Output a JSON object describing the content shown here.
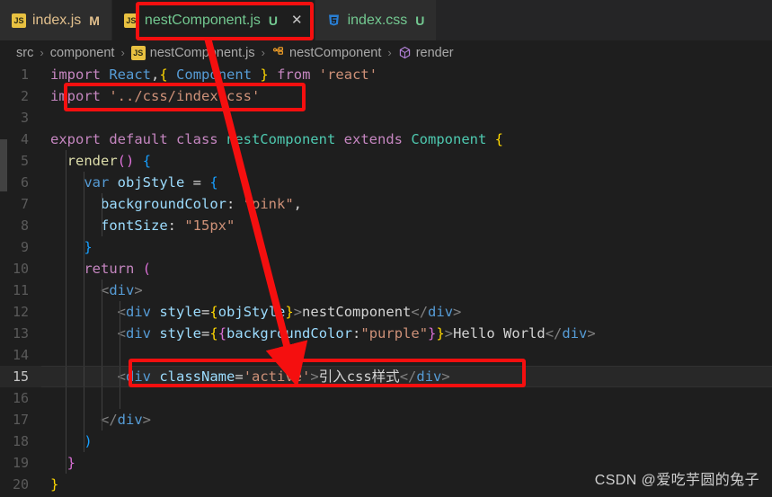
{
  "window": {
    "theme_bg": "#1e1e1e",
    "accent_red": "#f50f0f"
  },
  "tabs": [
    {
      "label": "index.js",
      "icon": "js-file-icon",
      "badge": "M",
      "status": "modified",
      "active": false,
      "closable": false
    },
    {
      "label": "nestComponent.js",
      "icon": "js-file-icon",
      "badge": "U",
      "status": "untracked",
      "active": true,
      "closable": true,
      "close_glyph": "✕"
    },
    {
      "label": "index.css",
      "icon": "css-file-icon",
      "badge": "U",
      "status": "untracked",
      "active": false,
      "closable": false
    }
  ],
  "breadcrumb": {
    "items": [
      {
        "label": "src",
        "icon": null
      },
      {
        "label": "component",
        "icon": null
      },
      {
        "label": "nestComponent.js",
        "icon": "js-file-icon"
      },
      {
        "label": "nestComponent",
        "icon": "class-icon"
      },
      {
        "label": "render",
        "icon": "method-icon"
      }
    ],
    "separator": "›"
  },
  "editor": {
    "current_line": 15,
    "lines": [
      {
        "n": "1",
        "text": "import React,{ Component } from 'react'"
      },
      {
        "n": "2",
        "text": "import '../css/index.css'"
      },
      {
        "n": "3",
        "text": ""
      },
      {
        "n": "4",
        "text": "export default class nestComponent extends Component {"
      },
      {
        "n": "5",
        "text": "  render() {"
      },
      {
        "n": "6",
        "text": "    var objStyle = {"
      },
      {
        "n": "7",
        "text": "      backgroundColor: \"pink\","
      },
      {
        "n": "8",
        "text": "      fontSize: \"15px\""
      },
      {
        "n": "9",
        "text": "    }"
      },
      {
        "n": "10",
        "text": "    return ("
      },
      {
        "n": "11",
        "text": "      <div>"
      },
      {
        "n": "12",
        "text": "        <div style={objStyle}>nestComponent</div>"
      },
      {
        "n": "13",
        "text": "        <div style={{backgroundColor:\"purple\"}}>Hello World</div>"
      },
      {
        "n": "14",
        "text": ""
      },
      {
        "n": "15",
        "text": "        <div className='active'>引入css样式</div>"
      },
      {
        "n": "16",
        "text": ""
      },
      {
        "n": "17",
        "text": "      </div>"
      },
      {
        "n": "18",
        "text": "    )"
      },
      {
        "n": "19",
        "text": "  }"
      },
      {
        "n": "20",
        "text": "}"
      }
    ]
  },
  "annotations": {
    "boxes": [
      {
        "name": "tab-highlight-box",
        "target": "nestComponent.js tab"
      },
      {
        "name": "import-css-highlight-box",
        "target": "line 2 import '../css/index.css'"
      },
      {
        "name": "classname-highlight-box",
        "target": "line 15 <div className='active'>"
      }
    ],
    "arrow": {
      "name": "annotation-arrow",
      "from": "nestComponent.js tab",
      "to": "line 15"
    }
  },
  "watermark": {
    "text": "CSDN @爱吃芋圆的兔子"
  }
}
